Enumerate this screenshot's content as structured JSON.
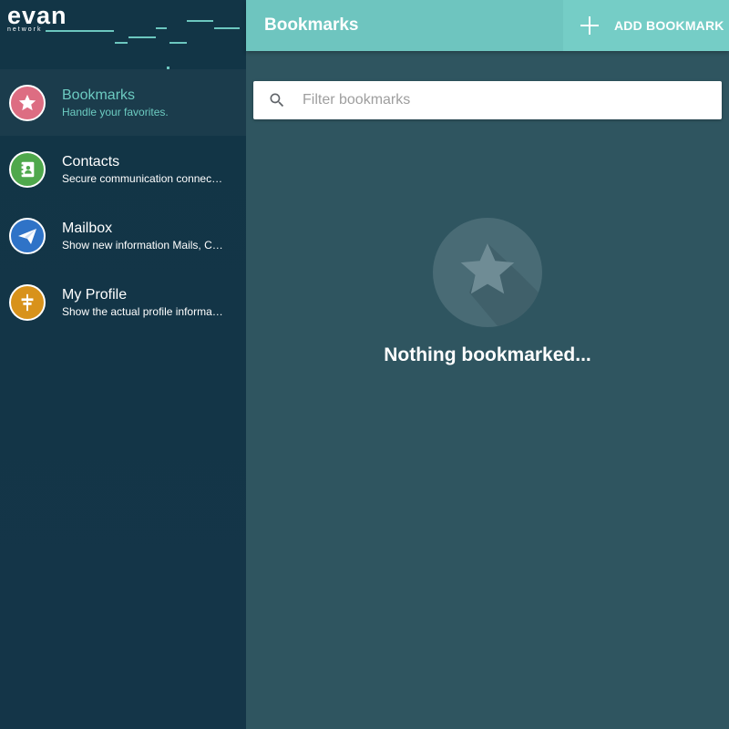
{
  "brand": {
    "name": "evan",
    "sub": "network"
  },
  "header": {
    "title": "Bookmarks",
    "add_label": "ADD BOOKMARK"
  },
  "search": {
    "placeholder": "Filter bookmarks",
    "value": ""
  },
  "nav": {
    "items": [
      {
        "title": "Bookmarks",
        "desc": "Handle your favorites.",
        "icon": "star-icon",
        "color": "#dd6d82",
        "active": true
      },
      {
        "title": "Contacts",
        "desc": "Secure communication connec…",
        "icon": "contacts-book-icon",
        "color": "#4fa84c",
        "active": false
      },
      {
        "title": "Mailbox",
        "desc": "Show new information Mails, C…",
        "icon": "mail-plane-icon",
        "color": "#2f73c7",
        "active": false
      },
      {
        "title": "My Profile",
        "desc": "Show the actual profile informa…",
        "icon": "profile-signpost-icon",
        "color": "#d8921b",
        "active": false
      }
    ]
  },
  "empty": {
    "message": "Nothing bookmarked...",
    "icon": "star-icon"
  },
  "colors": {
    "accent": "#6ec5bf",
    "sidebar": "#133546",
    "content": "#2f5560"
  }
}
